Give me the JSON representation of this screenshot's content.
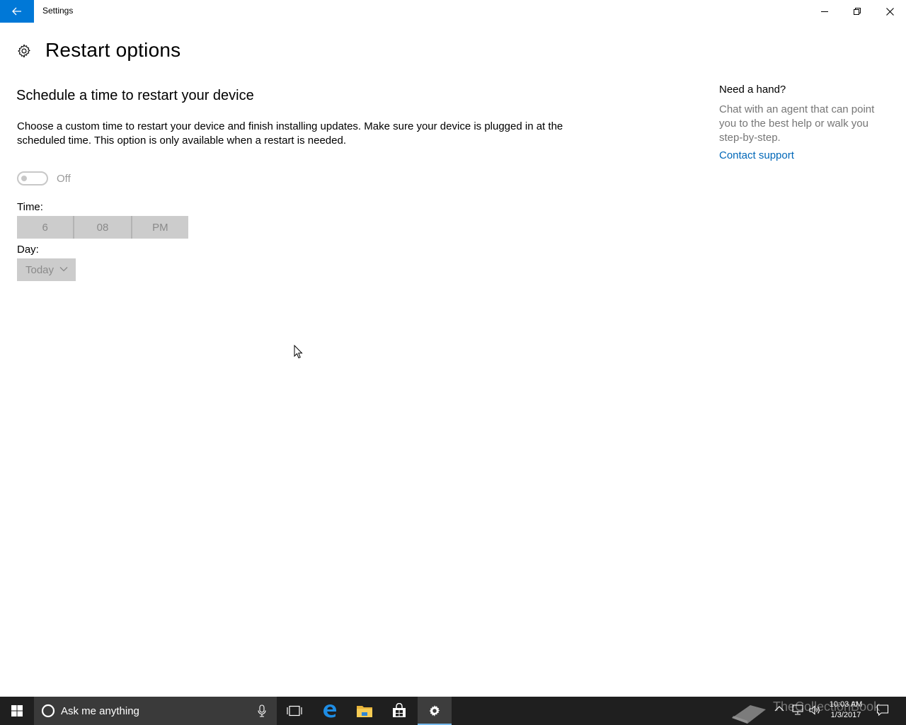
{
  "window": {
    "title": "Settings"
  },
  "header": {
    "page_title": "Restart options"
  },
  "main": {
    "section_title": "Schedule a time to restart your device",
    "description": "Choose a custom time to restart your device and finish installing updates. Make sure your device is plugged in at the scheduled time. This option is only available when a restart is needed.",
    "toggle": {
      "state_label": "Off",
      "on": false
    },
    "time": {
      "label": "Time:",
      "hour": "6",
      "minute": "08",
      "period": "PM"
    },
    "day": {
      "label": "Day:",
      "value": "Today"
    }
  },
  "help": {
    "title": "Need a hand?",
    "text": "Chat with an agent that can point you to the best help or walk you step-by-step.",
    "link": "Contact support"
  },
  "taskbar": {
    "search_placeholder": "Ask me anything",
    "watermark": "TheCollectionBook",
    "clock_time": "10:03 AM",
    "clock_date": "1/3/2017",
    "icons": [
      "windows-start-icon",
      "cortana-icon",
      "microphone-icon",
      "task-view-icon",
      "edge-icon",
      "file-explorer-icon",
      "store-icon",
      "settings-icon",
      "tray-chevron-icon",
      "network-icon",
      "volume-icon",
      "action-center-icon"
    ]
  },
  "colors": {
    "accent": "#0078d7",
    "link": "#0067b8",
    "disabled_bg": "#cccccc",
    "taskbar": "#1f1f1f"
  }
}
